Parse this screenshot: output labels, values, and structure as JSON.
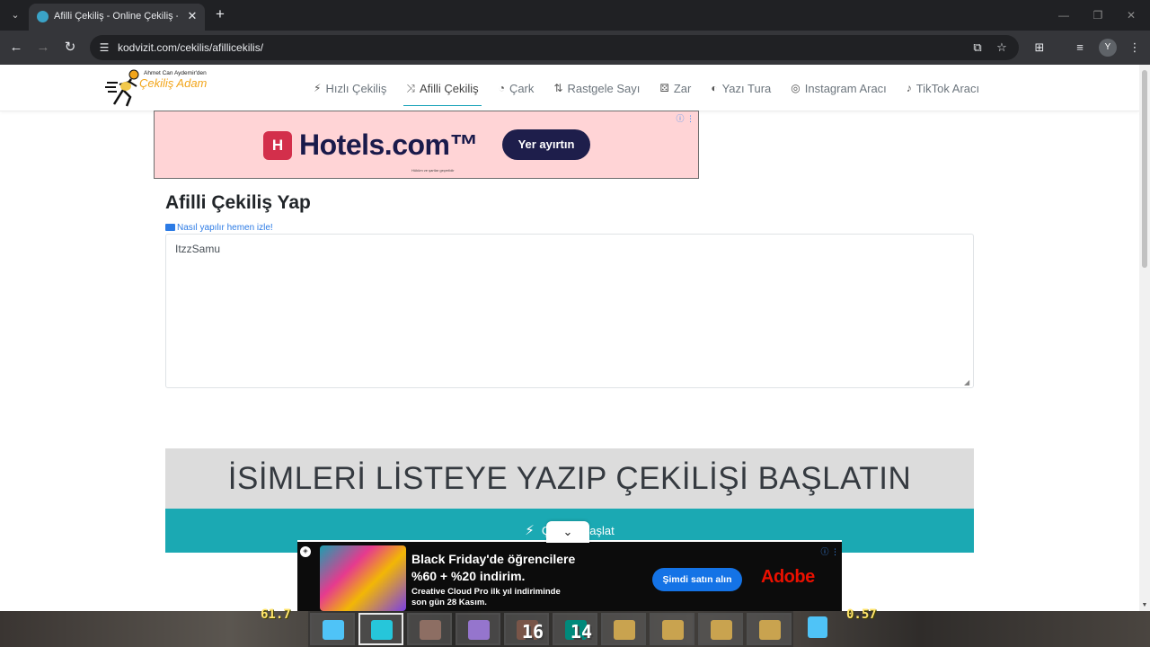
{
  "browser": {
    "tab_list_glyph": "⌄",
    "tab_title": "Afilli Çekiliş - Online Çekiliş - H",
    "tab_close": "✕",
    "new_tab": "+",
    "back": "←",
    "forward": "→",
    "reload": "↻",
    "url": "kodvizit.com/cekilis/afillicekilis/",
    "minimize": "—",
    "restore": "❐",
    "close": "✕",
    "profile_initial": "Y",
    "icons": [
      "install-icon",
      "star-icon",
      "extensions-icon",
      "media-icon",
      "menu-icon"
    ]
  },
  "site": {
    "logo_top": "Ahmet Can Aydemir'den",
    "logo_main": "Çekiliş Adam",
    "menu": [
      {
        "icon": "⚡",
        "label": "Hızlı Çekiliş"
      },
      {
        "icon": "⤨",
        "label": "Afilli Çekiliş"
      },
      {
        "icon": "◔",
        "label": "Çark"
      },
      {
        "icon": "⇅",
        "label": "Rastgele Sayı"
      },
      {
        "icon": "⚄",
        "label": "Zar"
      },
      {
        "icon": "◐",
        "label": "Yazı Tura"
      },
      {
        "icon": "◎",
        "label": "Instagram Aracı"
      },
      {
        "icon": "♪",
        "label": "TikTok Aracı"
      }
    ],
    "active_menu": "Afilli Çekiliş"
  },
  "ad_top": {
    "logo_letter": "H",
    "brand": "Hotels.com™",
    "cta": "Yer ayırtın",
    "fine_print": "Hüküm ve şartlar geçerlidir",
    "info": "ⓘ ⋮"
  },
  "main": {
    "title": "Afilli Çekiliş Yap",
    "video_link": "Nasıl yapılır hemen izle!",
    "names_value": "ItzzSamu",
    "banner_text": "İSİMLERİ LİSTEYE YAZIP ÇEKİLİŞİ BAŞLATIN",
    "start_button_label": "Çekilişi Başlat",
    "start_button_icon": "⚡"
  },
  "ad_bottom": {
    "headline_line1": "Black Friday'de öğrencilere",
    "headline_line2": "%60 + %20 indirim.",
    "sub_line1": "Creative Cloud Pro ilk yıl indiriminde",
    "sub_line2": "son gün 28 Kasım.",
    "cta": "Şimdi satın alın",
    "brand": "Adobe",
    "info": "ⓘ ⋮",
    "collapse_glyph": "⌄"
  },
  "game_hotbar": {
    "left_hud": "61.7",
    "right_hud": "0.57",
    "counts": [
      "16",
      "14"
    ]
  },
  "colors": {
    "accent_teal": "#1ba9b3",
    "link_blue": "#2c7be5",
    "ad_pink": "#ffd4d6",
    "adobe_red": "#eb1000"
  }
}
